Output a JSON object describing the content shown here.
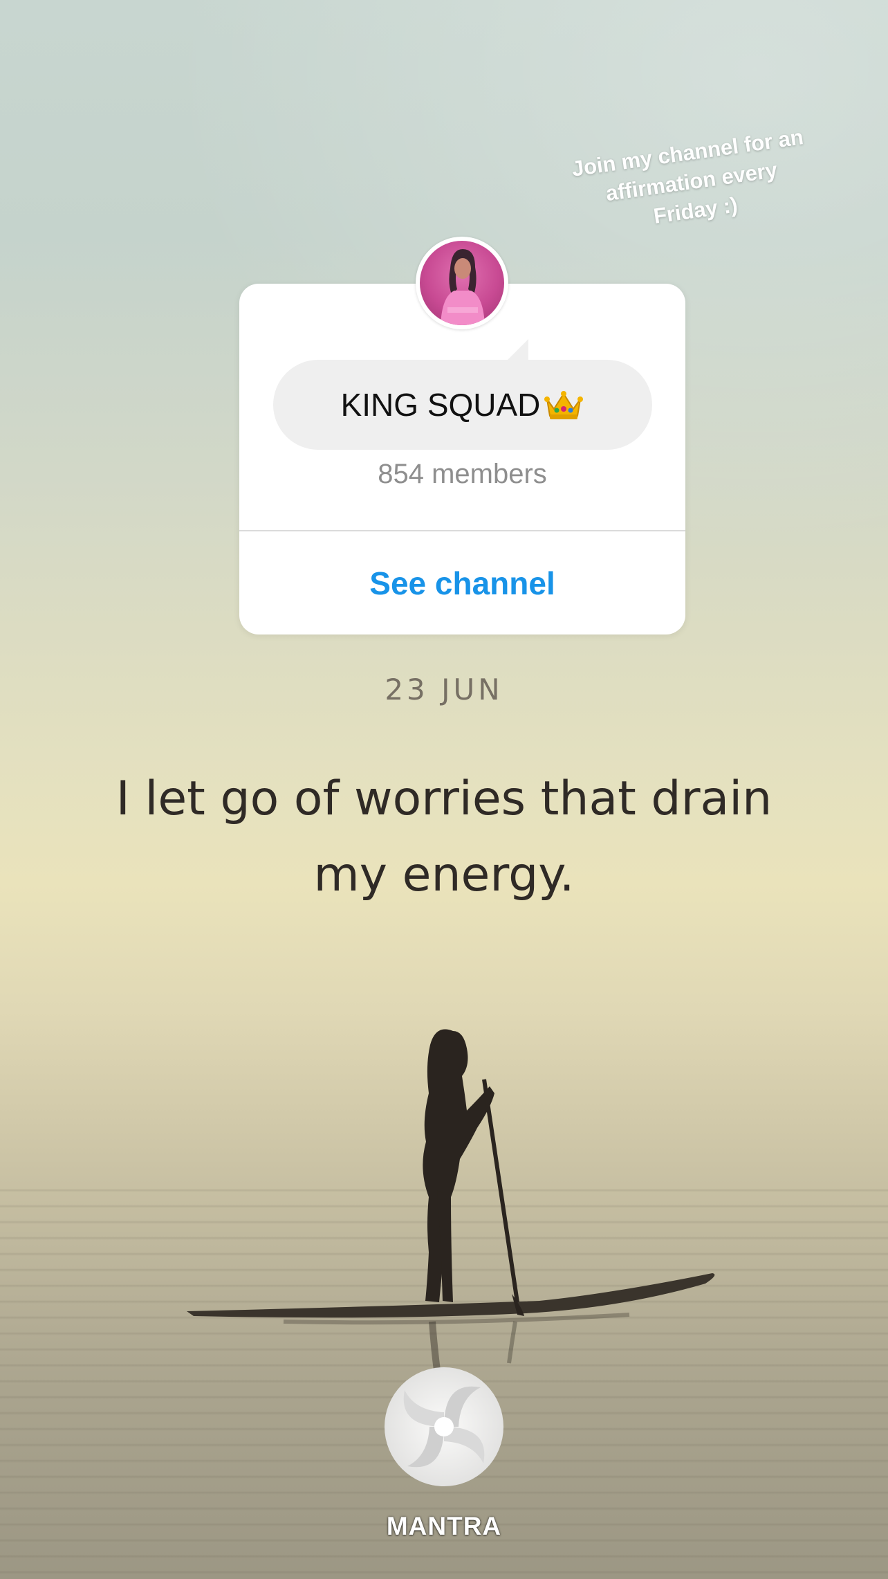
{
  "sticker": {
    "text_line1": "Join my channel for an",
    "text_line2": "affirmation every",
    "text_line3": "Friday :)"
  },
  "channel_card": {
    "name": "KING SQUAD",
    "name_emoji": "crown-emoji",
    "members": "854 members",
    "action_label": "See channel",
    "action_color": "#1893e8"
  },
  "affirmation": {
    "date": "23 JUN",
    "text_line1": "I let go of worries that drain",
    "text_line2": "my energy."
  },
  "brand": {
    "name": "MANTRA",
    "logo_icon": "mantra-swirl-logo"
  }
}
